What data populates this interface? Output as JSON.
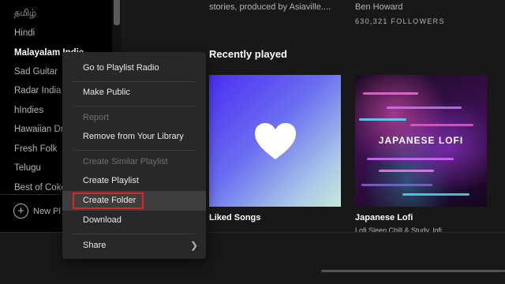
{
  "sidebar": {
    "items": [
      {
        "label": "தமிழ்",
        "active": false
      },
      {
        "label": "Hindi",
        "active": false
      },
      {
        "label": "Malayalam Indie",
        "active": true
      },
      {
        "label": "Sad Guitar",
        "active": false
      },
      {
        "label": "Radar India",
        "active": false
      },
      {
        "label": "hIndies",
        "active": false
      },
      {
        "label": "Hawaiian Dr",
        "active": false
      },
      {
        "label": "Fresh Folk",
        "active": false
      },
      {
        "label": "Telugu",
        "active": false
      },
      {
        "label": "Best of Coke",
        "active": false
      }
    ],
    "new_playlist_label": "New Pl",
    "plus_icon": "plus-circle-icon"
  },
  "main": {
    "top_description": "stories, produced by Asiaville....",
    "top_artist": "Ben Howard",
    "top_followers": "630,321 FOLLOWERS",
    "section_title": "Recently played",
    "cards": [
      {
        "name": "Liked Songs",
        "subtitle": "",
        "icon": "heart-icon",
        "colors": [
          "#4a2ef5",
          "#a9c7e8",
          "#c4ead8"
        ]
      },
      {
        "name": "Japanese Lofi",
        "subtitle": "Lofi Sleep Chill & Study, lofi",
        "art_text": "JAPANESE LOFI"
      }
    ]
  },
  "context_menu": {
    "items": [
      {
        "label": "Go to Playlist Radio",
        "disabled": false
      },
      {
        "label": "Make Public",
        "disabled": false
      },
      {
        "label": "Report",
        "disabled": true
      },
      {
        "label": "Remove from Your Library",
        "disabled": false
      },
      {
        "label": "Create Similar Playlist",
        "disabled": true
      },
      {
        "label": "Create Playlist",
        "disabled": false
      },
      {
        "label": "Create Folder",
        "disabled": false,
        "highlighted": true
      },
      {
        "label": "Download",
        "disabled": false
      },
      {
        "label": "Share",
        "disabled": false,
        "submenu": true
      }
    ],
    "highlight_color": "#e02424"
  },
  "colors": {
    "background": "#121212",
    "sidebar": "#000000",
    "menu": "#282828",
    "text_primary": "#ffffff",
    "text_secondary": "#b3b3b3"
  }
}
